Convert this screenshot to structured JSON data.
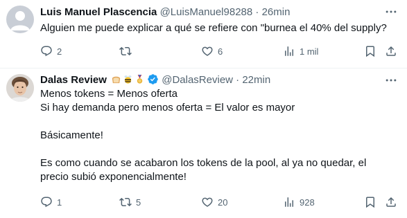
{
  "tweets": [
    {
      "name": "Luis Manuel Plascencia",
      "handle": "@LuisManuel98288",
      "separator": " · ",
      "time": "26min",
      "lines": [
        "Alguien me puede explicar a qué se refiere con \"burnea el 40% del supply?"
      ],
      "replies": "2",
      "retweets": "",
      "likes": "6",
      "views": "1 mil"
    },
    {
      "name": "Dalas Review",
      "handle": "@DalasReview",
      "separator": " · ",
      "time": "22min",
      "lines": [
        "Menos tokens = Menos oferta",
        "Si hay demanda pero menos oferta = El valor es mayor",
        "",
        "Básicamente!",
        "",
        "Es como cuando se acabaron los tokens de la pool, al ya no quedar, el",
        "precio subió exponencialmente!"
      ],
      "replies": "1",
      "retweets": "5",
      "likes": "20",
      "views": "928"
    }
  ],
  "colors": {
    "text": "#0f1419",
    "muted": "#536471",
    "verified": "#1d9bf0",
    "divider": "#eff3f4"
  },
  "icons": [
    "reply-icon",
    "retweet-icon",
    "like-icon",
    "views-icon",
    "bookmark-icon",
    "share-icon",
    "more-icon",
    "verified-icon"
  ]
}
